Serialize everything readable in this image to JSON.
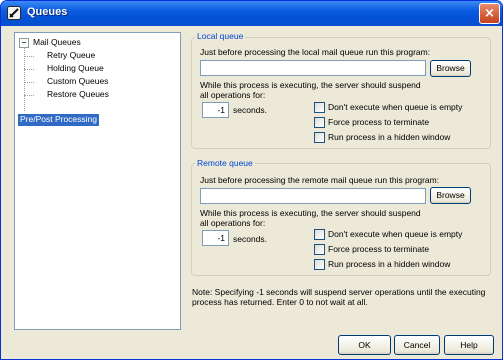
{
  "window": {
    "title": "Queues",
    "close_label": "×"
  },
  "tree": {
    "root": {
      "label": "Mail Queues",
      "expander": "−"
    },
    "children": [
      "Retry Queue",
      "Holding Queue",
      "Custom Queues",
      "Restore Queues"
    ],
    "selected": "Pre/Post Processing"
  },
  "local": {
    "legend": "Local queue",
    "program_label": "Just before processing the local mail queue run this program:",
    "program_value": "",
    "browse_label": "Browse",
    "suspend_label": "While this process is executing, the server should suspend all operations for:",
    "seconds_value": "-1",
    "seconds_label": "seconds.",
    "checks": [
      "Don't execute when queue is empty",
      "Force process to terminate",
      "Run process in a hidden window"
    ]
  },
  "remote": {
    "legend": "Remote queue",
    "program_label": "Just before processing the remote mail queue run this program:",
    "program_value": "",
    "browse_label": "Browse",
    "suspend_label": "While this process is executing, the server should suspend all operations for:",
    "seconds_value": "-1",
    "seconds_label": "seconds.",
    "checks": [
      "Don't execute when queue is empty",
      "Force process to terminate",
      "Run process in a hidden window"
    ]
  },
  "note": "Note:  Specifying -1 seconds will suspend server operations until the executing process has returned.  Enter 0 to not wait at all.",
  "footer": {
    "ok": "OK",
    "cancel": "Cancel",
    "help": "Help"
  }
}
